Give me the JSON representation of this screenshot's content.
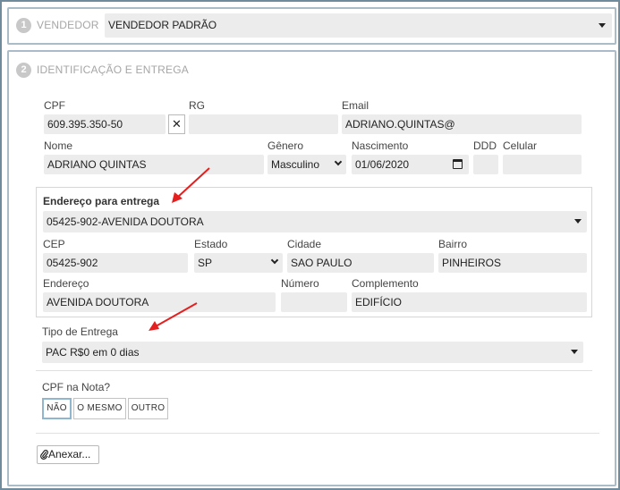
{
  "section1": {
    "number": "1",
    "title": "VENDEDOR",
    "seller_value": "VENDEDOR PADRÃO"
  },
  "section2": {
    "number": "2",
    "title": "IDENTIFICAÇÃO E ENTREGA",
    "cpf": {
      "label": "CPF",
      "value": "609.395.350-50",
      "clear_glyph": "✕"
    },
    "rg": {
      "label": "RG",
      "value": ""
    },
    "email": {
      "label": "Email",
      "value": "ADRIANO.QUINTAS@"
    },
    "nome": {
      "label": "Nome",
      "value": "ADRIANO QUINTAS"
    },
    "genero": {
      "label": "Gênero",
      "value": "Masculino"
    },
    "nascimento": {
      "label": "Nascimento",
      "value": "01/06/2020"
    },
    "ddd": {
      "label": "DDD",
      "value": ""
    },
    "celular": {
      "label": "Celular",
      "value": ""
    },
    "endereco_entrega": {
      "title": "Endereço para entrega",
      "selected": "05425-902-AVENIDA DOUTORA",
      "cep": {
        "label": "CEP",
        "value": "05425-902"
      },
      "estado": {
        "label": "Estado",
        "value": "SP"
      },
      "cidade": {
        "label": "Cidade",
        "value": "SAO PAULO"
      },
      "bairro": {
        "label": "Bairro",
        "value": "PINHEIROS"
      },
      "endereco": {
        "label": "Endereço",
        "value": "AVENIDA DOUTORA"
      },
      "numero": {
        "label": "Número",
        "value": ""
      },
      "complemento": {
        "label": "Complemento",
        "value": "EDIFÍCIO"
      }
    },
    "tipo_entrega": {
      "label": "Tipo de Entrega",
      "value": "PAC R$0 em 0 dias"
    },
    "cpf_nota": {
      "label": "CPF na Nota?",
      "options": [
        "NÃO",
        "O MESMO",
        "OUTRO"
      ],
      "selected": "NÃO"
    },
    "anexar_label": "Anexar..."
  },
  "colors": {
    "border_outer": "#6f8b9c",
    "border_section": "#a9bcc8",
    "field_bg": "#ececec",
    "arrow_red": "#e41f1f",
    "active_option": "#8fb6cf"
  },
  "icons": {
    "step_badge": "circle-number-icon",
    "dropdown": "caret-down-icon",
    "calendar": "calendar-icon",
    "clear": "close-icon",
    "attach": "paperclip-icon",
    "annotation": "red-arrow-icon"
  }
}
